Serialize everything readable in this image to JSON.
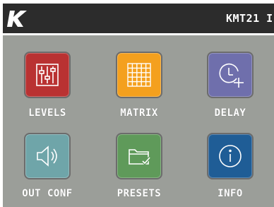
{
  "header": {
    "logo_text": "K",
    "device_name": "KMT21 I"
  },
  "menu": [
    {
      "label": "LEVELS",
      "icon": "sliders-icon",
      "color": "#b93232"
    },
    {
      "label": "MATRIX",
      "icon": "grid-icon",
      "color": "#f4a01e"
    },
    {
      "label": "DELAY",
      "icon": "clock-plus-icon",
      "color": "#6f6fac"
    },
    {
      "label": "OUT CONF",
      "icon": "speaker-icon",
      "color": "#6fa5a9"
    },
    {
      "label": "PRESETS",
      "icon": "folder-check-icon",
      "color": "#5f9a5a"
    },
    {
      "label": "INFO",
      "icon": "info-icon",
      "color": "#1f5d96"
    }
  ]
}
